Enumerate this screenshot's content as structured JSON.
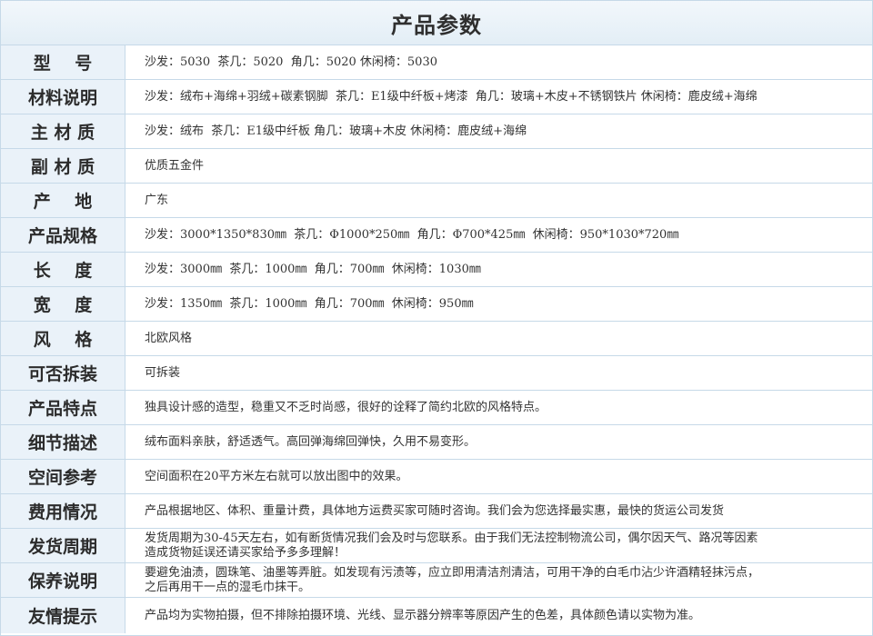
{
  "title": "产品参数",
  "rows": [
    {
      "label": "型    号",
      "value": "沙发：5030  茶几：5020  角几：5020 休闲椅：5030"
    },
    {
      "label": "材料说明",
      "value": "沙发：绒布+海绵+羽绒+碳素钢脚  茶几：E1级中纤板+烤漆  角几：玻璃+木皮+不锈钢铁片 休闲椅：鹿皮绒+海绵"
    },
    {
      "label": "主 材 质",
      "value": "沙发：绒布  茶几：E1级中纤板 角几：玻璃+木皮 休闲椅：鹿皮绒+海绵"
    },
    {
      "label": "副 材 质",
      "value": "优质五金件"
    },
    {
      "label": "产    地",
      "value": "广东"
    },
    {
      "label": "产品规格",
      "value": "沙发：3000*1350*830㎜  茶几：Φ1000*250㎜  角几：Φ700*425㎜  休闲椅：950*1030*720㎜"
    },
    {
      "label": "长    度",
      "value": "沙发：3000㎜  茶几：1000㎜  角几：700㎜  休闲椅：1030㎜"
    },
    {
      "label": "宽    度",
      "value": "沙发：1350㎜  茶几：1000㎜  角几：700㎜  休闲椅：950㎜"
    },
    {
      "label": "风    格",
      "value": "北欧风格"
    },
    {
      "label": "可否拆装",
      "value": "可拆装"
    },
    {
      "label": "产品特点",
      "value": "独具设计感的造型，稳重又不乏时尚感，很好的诠释了简约北欧的风格特点。"
    },
    {
      "label": "细节描述",
      "value": "绒布面料亲肤，舒适透气。高回弹海绵回弹快，久用不易变形。"
    },
    {
      "label": "空间参考",
      "value": "空间面积在20平方米左右就可以放出图中的效果。"
    },
    {
      "label": "费用情况",
      "value": "产品根据地区、体积、重量计费，具体地方运费买家可随时咨询。我们会为您选择最实惠，最快的货运公司发货"
    },
    {
      "label": "发货周期",
      "value": "发货周期为30-45天左右，如有断货情况我们会及时与您联系。由于我们无法控制物流公司，偶尔因天气、路况等因素\n造成货物延误还请买家给予多多理解！"
    },
    {
      "label": "保养说明",
      "value": "要避免油渍，圆珠笔、油墨等弄脏。如发现有污渍等，应立即用清洁剂清洁，可用干净的白毛巾沾少许酒精轻抹污点，\n之后再用干一点的湿毛巾抹干。"
    },
    {
      "label": "友情提示",
      "value": "产品均为实物拍摄，但不排除拍摄环境、光线、显示器分辨率等原因产生的色差，具体颜色请以实物为准。"
    }
  ]
}
